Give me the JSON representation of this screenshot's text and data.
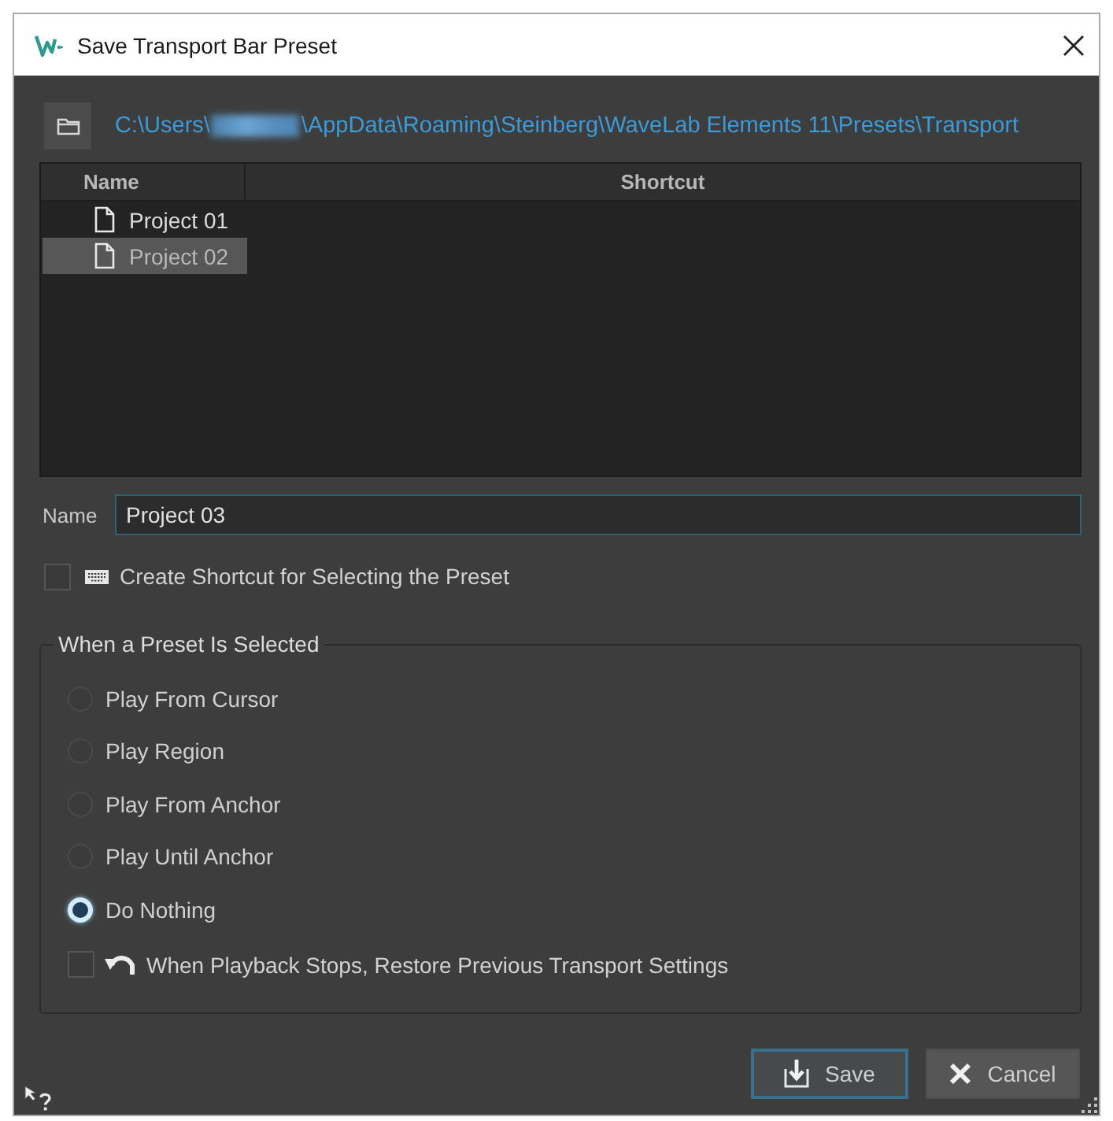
{
  "window": {
    "title": "Save Transport Bar Preset"
  },
  "path_bar": {
    "path_start": "C:\\Users\\",
    "path_end": "\\AppData\\Roaming\\Steinberg\\WaveLab Elements 11\\Presets\\Transport"
  },
  "preset_list": {
    "columns": [
      "Name",
      "Shortcut"
    ],
    "rows": [
      {
        "name": "Project 01",
        "selected": false
      },
      {
        "name": "Project 02",
        "selected": true
      }
    ]
  },
  "name_field": {
    "label": "Name",
    "value": "Project 03"
  },
  "create_shortcut": {
    "label": "Create Shortcut for Selecting the Preset",
    "checked": false
  },
  "selection_group": {
    "title": "When a Preset Is Selected",
    "options": [
      {
        "label": "Play From Cursor",
        "selected": false
      },
      {
        "label": "Play Region",
        "selected": false
      },
      {
        "label": "Play From Anchor",
        "selected": false
      },
      {
        "label": "Play Until Anchor",
        "selected": false
      },
      {
        "label": "Do Nothing",
        "selected": true
      }
    ],
    "restore": {
      "label": "When Playback Stops, Restore Previous Transport Settings",
      "checked": false
    }
  },
  "buttons": [
    {
      "kind": "save",
      "label": "Save",
      "focused": true
    },
    {
      "kind": "cancel",
      "label": "Cancel",
      "focused": false
    }
  ]
}
